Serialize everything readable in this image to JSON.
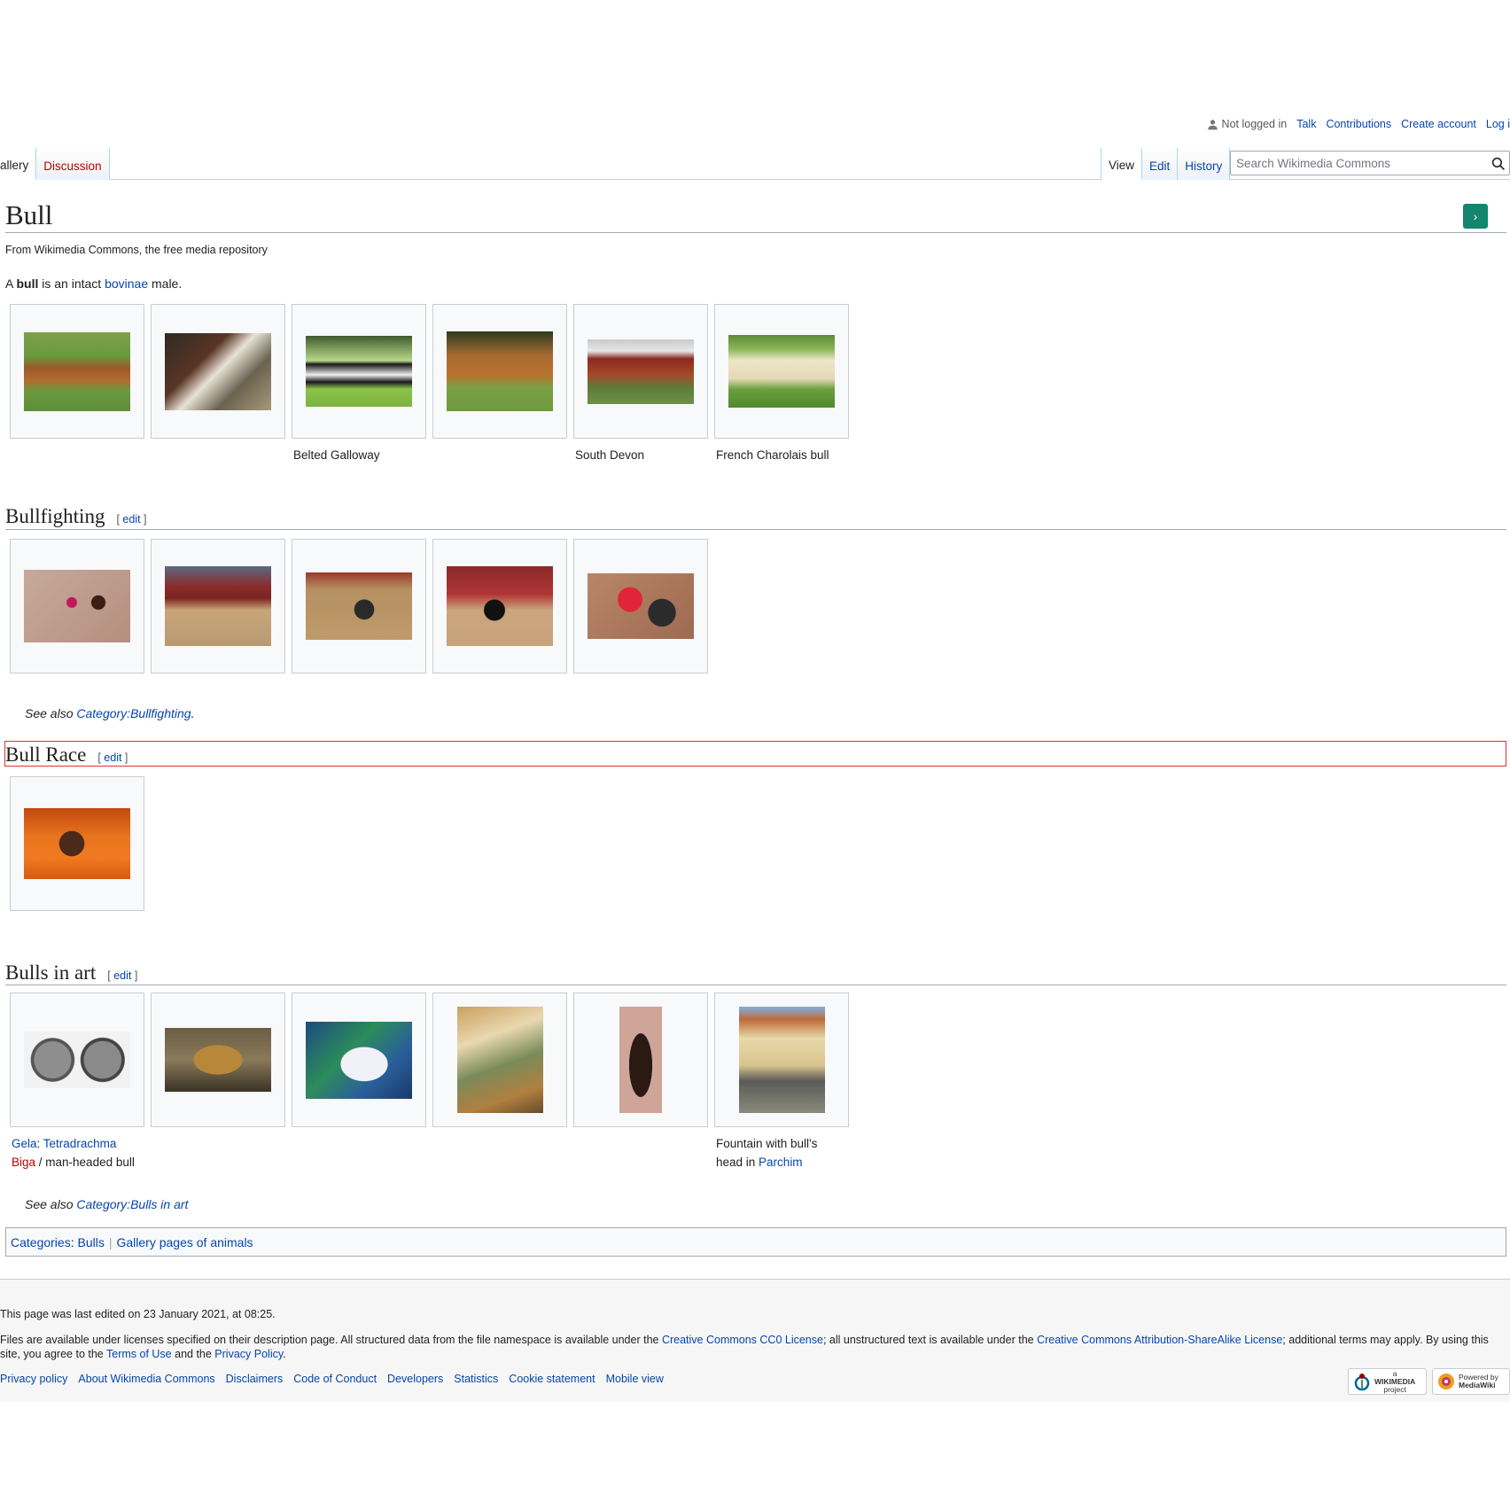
{
  "personal": {
    "status": "Not logged in",
    "links": [
      "Talk",
      "Contributions",
      "Create account",
      "Log i"
    ]
  },
  "tabs": {
    "left": [
      "allery",
      "Discussion"
    ],
    "right": [
      "View",
      "Edit",
      "History"
    ]
  },
  "search": {
    "placeholder": "Search Wikimedia Commons"
  },
  "page": {
    "title": "Bull",
    "tagline": "From Wikimedia Commons, the free media repository",
    "intro": {
      "a": "A ",
      "bold": "bull",
      "mid": " is an intact ",
      "link": "bovinae",
      "end": " male."
    }
  },
  "gallery1": {
    "captions": [
      "",
      "",
      "Belted Galloway",
      "",
      "South Devon",
      "French Charolais bull"
    ]
  },
  "sections": {
    "bullfighting": {
      "title": "Bullfighting",
      "edit": "edit",
      "see_also_prefix": "See also ",
      "see_also_link": "Category:Bullfighting",
      "see_also_suffix": "."
    },
    "bull_race": {
      "title": "Bull Race",
      "edit": "edit"
    },
    "art": {
      "title": "Bulls in art",
      "edit": "edit",
      "caption1": {
        "link1": "Gela",
        "sep": ": ",
        "link2": "Tetradrachma",
        "link3": "Biga",
        "rest": " / man-headed bull"
      },
      "caption6": {
        "text": "Fountain with bull's head in ",
        "link": "Parchim"
      },
      "see_also_prefix": "See also ",
      "see_also_link": "Category:Bulls in art"
    }
  },
  "categories": {
    "label": "Categories",
    "items": [
      "Bulls",
      "Gallery pages of animals"
    ]
  },
  "footer": {
    "last_edited": "This page was last edited on 23 January 2021, at 08:25.",
    "license": {
      "t1": "Files are available under licenses specified on their description page. All structured data from the file namespace is available under the ",
      "l1": "Creative Commons CC0 License",
      "t2": "; all unstructured text is available under the ",
      "l2": "Creative Commons Attribution-ShareAlike License",
      "t3": "; additional terms may apply. By using this site, you agree to the ",
      "l3": "Terms of Use",
      "t4": " and the ",
      "l4": "Privacy Policy",
      "t5": "."
    },
    "places": [
      "Privacy policy",
      "About Wikimedia Commons",
      "Disclaimers",
      "Code of Conduct",
      "Developers",
      "Statistics",
      "Cookie statement",
      "Mobile view"
    ],
    "badge_wikimedia": [
      "a",
      "WIKIMEDIA",
      "project"
    ],
    "badge_mediawiki": [
      "Powered by",
      "MediaWiki"
    ]
  },
  "colors": {
    "link": "#0645ad",
    "redlink": "#ba0000",
    "green_button": "#14866d",
    "highlight": "#e03030"
  }
}
